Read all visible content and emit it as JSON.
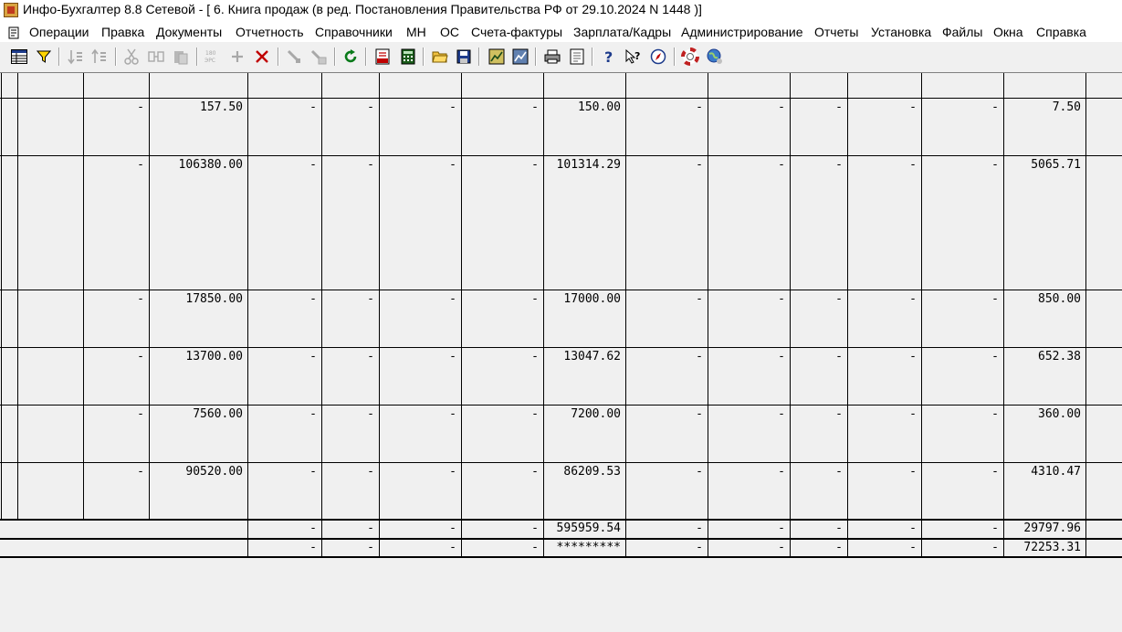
{
  "window": {
    "title": "Инфо-Бухгалтер 8.8 Сетевой - [  6. Книга продаж (в ред. Постановления Правительства РФ от 29.10.2024 N 1448 )]"
  },
  "menu": [
    "Операции",
    "Правка",
    "Документы",
    "Отчетность",
    "Справочники",
    "МН",
    "ОС",
    "Счета-фактуры",
    "Зарплата/Кадры",
    "Администрирование",
    "Отчеты",
    "Установка",
    "Файлы",
    "Окна",
    "Справка"
  ],
  "toolbar": [
    "grid-view-icon",
    "filter-icon",
    "sort-asc-icon",
    "sort-desc-icon",
    "cut-icon",
    "compare-icon",
    "paste-icon",
    "numbering-icon",
    "add-icon",
    "delete-icon",
    "tool-icon",
    "tool-data-icon",
    "refresh-icon",
    "pdf-export-icon",
    "calculator-icon",
    "open-folder-icon",
    "save-icon",
    "report-icon",
    "report2-icon",
    "print-icon",
    "preview-icon",
    "help-icon",
    "context-help-icon",
    "navigator-icon",
    "support-icon",
    "web-icon"
  ],
  "rows": [
    {
      "c2": "-",
      "c3": "157.50",
      "c4": "-",
      "c5": "-",
      "c6": "-",
      "c7": "-",
      "c8": "150.00",
      "c9": "-",
      "c10": "-",
      "c11": "-",
      "c12": "-",
      "c13": "-",
      "c14": "7.50"
    },
    {
      "c2": "-",
      "c3": "106380.00",
      "c4": "-",
      "c5": "-",
      "c6": "-",
      "c7": "-",
      "c8": "101314.29",
      "c9": "-",
      "c10": "-",
      "c11": "-",
      "c12": "-",
      "c13": "-",
      "c14": "5065.71"
    },
    {
      "c2": "-",
      "c3": "17850.00",
      "c4": "-",
      "c5": "-",
      "c6": "-",
      "c7": "-",
      "c8": "17000.00",
      "c9": "-",
      "c10": "-",
      "c11": "-",
      "c12": "-",
      "c13": "-",
      "c14": "850.00"
    },
    {
      "c2": "-",
      "c3": "13700.00",
      "c4": "-",
      "c5": "-",
      "c6": "-",
      "c7": "-",
      "c8": "13047.62",
      "c9": "-",
      "c10": "-",
      "c11": "-",
      "c12": "-",
      "c13": "-",
      "c14": "652.38"
    },
    {
      "c2": "-",
      "c3": "7560.00",
      "c4": "-",
      "c5": "-",
      "c6": "-",
      "c7": "-",
      "c8": "7200.00",
      "c9": "-",
      "c10": "-",
      "c11": "-",
      "c12": "-",
      "c13": "-",
      "c14": "360.00"
    },
    {
      "c2": "-",
      "c3": "90520.00",
      "c4": "-",
      "c5": "-",
      "c6": "-",
      "c7": "-",
      "c8": "86209.53",
      "c9": "-",
      "c10": "-",
      "c11": "-",
      "c12": "-",
      "c13": "-",
      "c14": "4310.47"
    }
  ],
  "totals": [
    {
      "c4": "-",
      "c5": "-",
      "c6": "-",
      "c7": "-",
      "c8": "595959.54",
      "c9": "-",
      "c10": "-",
      "c11": "-",
      "c12": "-",
      "c13": "-",
      "c14": "29797.96"
    },
    {
      "c4": "-",
      "c5": "-",
      "c6": "-",
      "c7": "-",
      "c8": "*********",
      "c9": "-",
      "c10": "-",
      "c11": "-",
      "c12": "-",
      "c13": "-",
      "c14": "72253.31"
    }
  ]
}
